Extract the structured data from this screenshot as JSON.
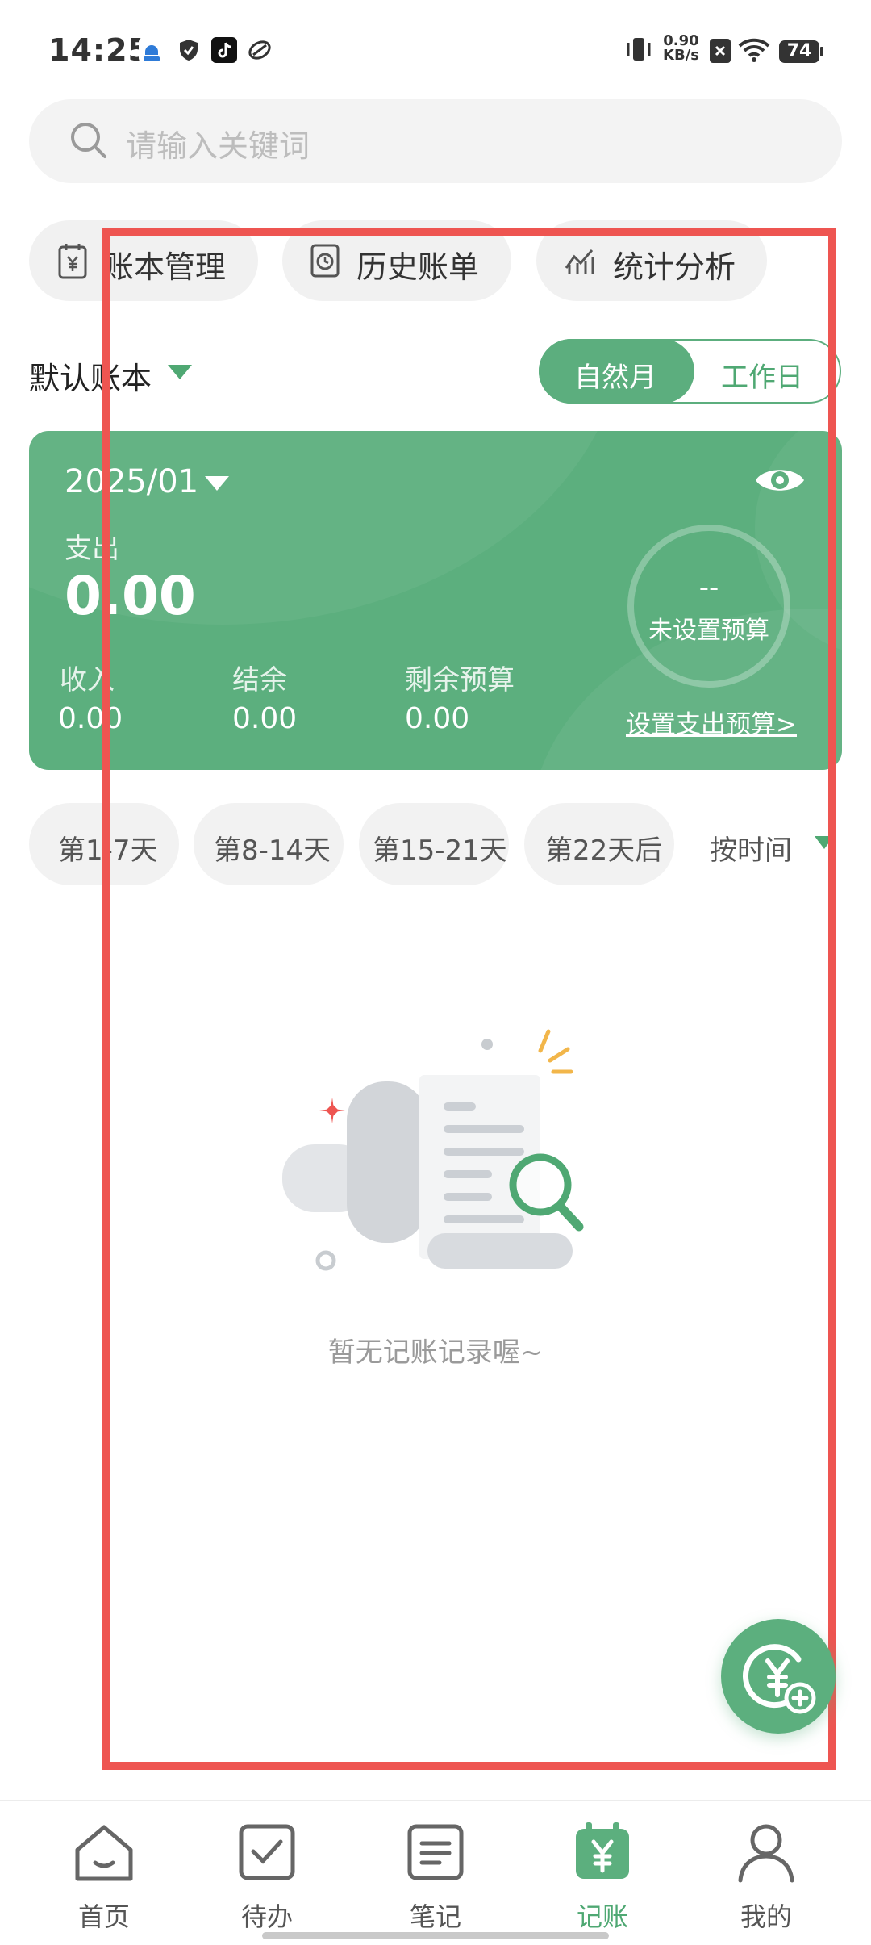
{
  "status_bar": {
    "time": "14:25",
    "net_rate_value": "0.90",
    "net_rate_unit": "KB/s",
    "battery": "74",
    "icons": [
      "app-icon",
      "shield-icon",
      "tiktok-icon",
      "leaf-icon",
      "vibrate-icon",
      "sim-off-icon",
      "wifi-icon",
      "battery-icon"
    ]
  },
  "search": {
    "placeholder": "请输入关键词"
  },
  "quick_actions": [
    {
      "label": "账本管理",
      "icon": "ledger-icon"
    },
    {
      "label": "历史账单",
      "icon": "history-bill-icon"
    },
    {
      "label": "统计分析",
      "icon": "analytics-icon"
    }
  ],
  "ledger": {
    "name": "默认账本",
    "modes": [
      "自然月",
      "工作日"
    ],
    "active_mode": "自然月"
  },
  "summary_card": {
    "period": "2025/01",
    "expense_label": "支出",
    "expense_value": "0.00",
    "income_label": "收入",
    "income_value": "0.00",
    "balance_label": "结余",
    "balance_value": "0.00",
    "remaining_budget_label": "剩余预算",
    "remaining_budget_value": "0.00",
    "budget_ring_value": "--",
    "budget_ring_text": "未设置预算",
    "set_budget_link": "设置支出预算>"
  },
  "filters": {
    "chips": [
      "第1-7天",
      "第8-14天",
      "第15-21天",
      "第22天后"
    ],
    "sort_label": "按时间"
  },
  "empty_state": {
    "text": "暂无记账记录喔~"
  },
  "bottom_nav": {
    "items": [
      {
        "label": "首页",
        "icon": "home-icon"
      },
      {
        "label": "待办",
        "icon": "todo-icon"
      },
      {
        "label": "笔记",
        "icon": "note-icon"
      },
      {
        "label": "记账",
        "icon": "bookkeeping-icon"
      },
      {
        "label": "我的",
        "icon": "profile-icon"
      }
    ],
    "active": "记账"
  },
  "colors": {
    "accent": "#5caf7e",
    "highlight_frame": "#ee5551",
    "text_muted": "#9a9a9a"
  }
}
